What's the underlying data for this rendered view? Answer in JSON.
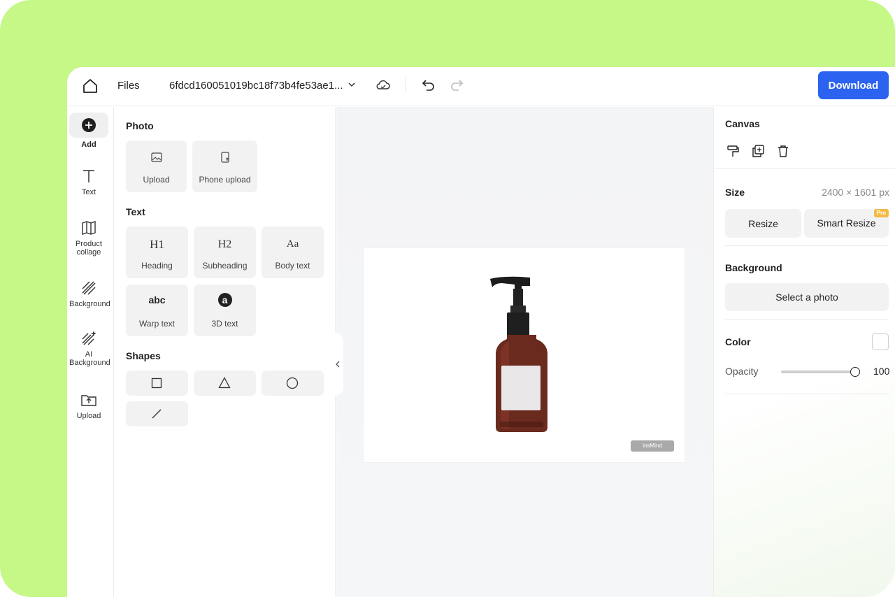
{
  "topbar": {
    "files_label": "Files",
    "file_name": "6fdcd160051019bc18f73b4fe53ae1...",
    "download_label": "Download"
  },
  "nav": {
    "items": [
      {
        "label": "Add",
        "icon": "plus-circle-icon"
      },
      {
        "label": "Text",
        "icon": "text-icon"
      },
      {
        "label": "Product collage",
        "icon": "collage-icon"
      },
      {
        "label": "Background",
        "icon": "hatched-background-icon"
      },
      {
        "label": "AI Background",
        "icon": "ai-background-icon"
      },
      {
        "label": "Upload",
        "icon": "upload-folder-icon"
      }
    ]
  },
  "panel": {
    "photo": {
      "title": "Photo",
      "items": [
        {
          "label": "Upload",
          "icon": "image-upload-icon"
        },
        {
          "label": "Phone upload",
          "icon": "phone-upload-icon"
        }
      ]
    },
    "text": {
      "title": "Text",
      "items": [
        {
          "label": "Heading",
          "glyph": "H1"
        },
        {
          "label": "Subheading",
          "glyph": "H2"
        },
        {
          "label": "Body text",
          "glyph": "Aa"
        },
        {
          "label": "Warp text",
          "glyph": "abc"
        },
        {
          "label": "3D text",
          "glyph": "a"
        }
      ]
    },
    "shapes": {
      "title": "Shapes",
      "items": [
        "square-icon",
        "triangle-icon",
        "circle-icon",
        "line-icon"
      ]
    }
  },
  "canvas": {
    "watermark": "insMind"
  },
  "props": {
    "canvas_title": "Canvas",
    "size_title": "Size",
    "size_value": "2400 × 1601 px",
    "resize_label": "Resize",
    "smart_resize_label": "Smart Resize",
    "pro_badge": "Pro",
    "background_title": "Background",
    "select_photo_label": "Select a photo",
    "color_title": "Color",
    "color_value": "#ffffff",
    "opacity_label": "Opacity",
    "opacity_value": "100",
    "opacity_fraction": 1.0
  },
  "colors": {
    "frame_green": "#c5f887",
    "accent_blue": "#2b63f0",
    "pro_badge": "#f5b944",
    "bottle_amber": "#6b2a1e"
  }
}
